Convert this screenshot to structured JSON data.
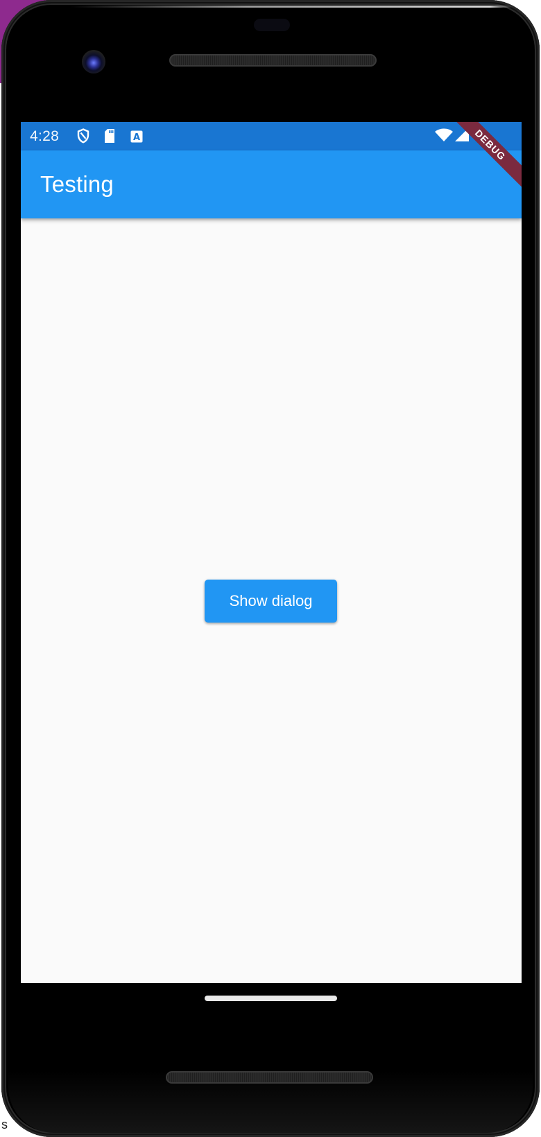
{
  "device": {
    "frame": "android-phone-emulator",
    "side_label": "s"
  },
  "status_bar": {
    "time": "4:28",
    "left_icons": [
      "shield-icon",
      "sd-card-icon",
      "accessibility-a-icon"
    ],
    "right_icons": [
      "wifi-icon",
      "cell-signal-icon"
    ],
    "color": "#1976d2"
  },
  "debug_banner": {
    "label": "DEBUG",
    "color": "#7b2a3f"
  },
  "app_bar": {
    "title": "Testing",
    "color": "#2196f3"
  },
  "main": {
    "background": "#fafafa",
    "button": {
      "label": "Show dialog",
      "color": "#2196f3"
    }
  },
  "nav": {
    "home_indicator": "gesture-pill"
  }
}
